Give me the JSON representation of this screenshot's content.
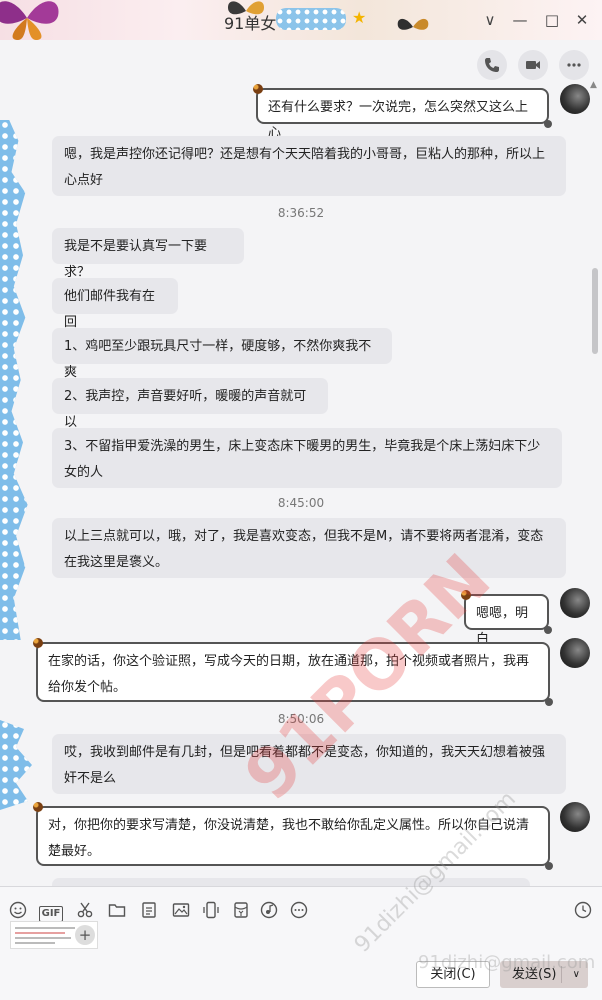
{
  "window": {
    "title": "91单女",
    "controls": {
      "collapse": "∨",
      "minimize": "—",
      "maximize": "□",
      "close": "✕"
    }
  },
  "header_actions": [
    {
      "name": "phone-call-icon"
    },
    {
      "name": "video-call-icon"
    },
    {
      "name": "more-icon"
    }
  ],
  "messages": {
    "m1": "还有什么要求？一次说完，怎么突然又这么上心",
    "m2": "嗯，我是声控你还记得吧？还是想有个天天陪着我的小哥哥，巨粘人的那种，所以上心点好",
    "t1": "8:36:52",
    "m3": "我是不是要认真写一下要求？",
    "m4": "他们邮件我有在回",
    "m5": "1、鸡吧至少跟玩具尺寸一样，硬度够，不然你爽我不爽",
    "m6": "2、我声控，声音要好听，暖暖的声音就可以",
    "m7": "3、不留指甲爱洗澡的男生，床上变态床下暖男的男生，毕竟我是个床上荡妇床下少女的人",
    "t2": "8:45:00",
    "m8": "以上三点就可以，哦，对了，我是喜欢变态，但我不是M，请不要将两者混淆，变态在我这里是褒义。",
    "m9": "嗯嗯，明白",
    "m10": "在家的话，你这个验证照，写成今天的日期，放在通道那，拍个视频或者照片，我再给你发个帖。",
    "t3": "8:50:06",
    "m11": "哎，我收到邮件是有几封，但是吧看着都都不是变态，你知道的，我天天幻想着被强奸不是么",
    "m12": "对，你把你的要求写清楚，你没说清楚，我也不敢给你乱定义属性。所以你自己说清楚最好。"
  },
  "toolbar": {
    "icons": [
      "emoji-icon",
      "gif-icon",
      "screenshot-scissors-icon",
      "folder-icon",
      "doc-icon",
      "image-icon",
      "phone-screen-icon",
      "red-packet-icon",
      "music-icon",
      "more-circle-icon"
    ],
    "gif_label": "GIF",
    "history_icon": "clock-icon"
  },
  "buttons": {
    "close": "关闭(C)",
    "send": "发送(S)",
    "send_more": "∨"
  },
  "watermark": {
    "main": "91PORN",
    "email_diag": "91dizhi@gmail.com",
    "email_line": "91dizhi@gmail.com"
  }
}
